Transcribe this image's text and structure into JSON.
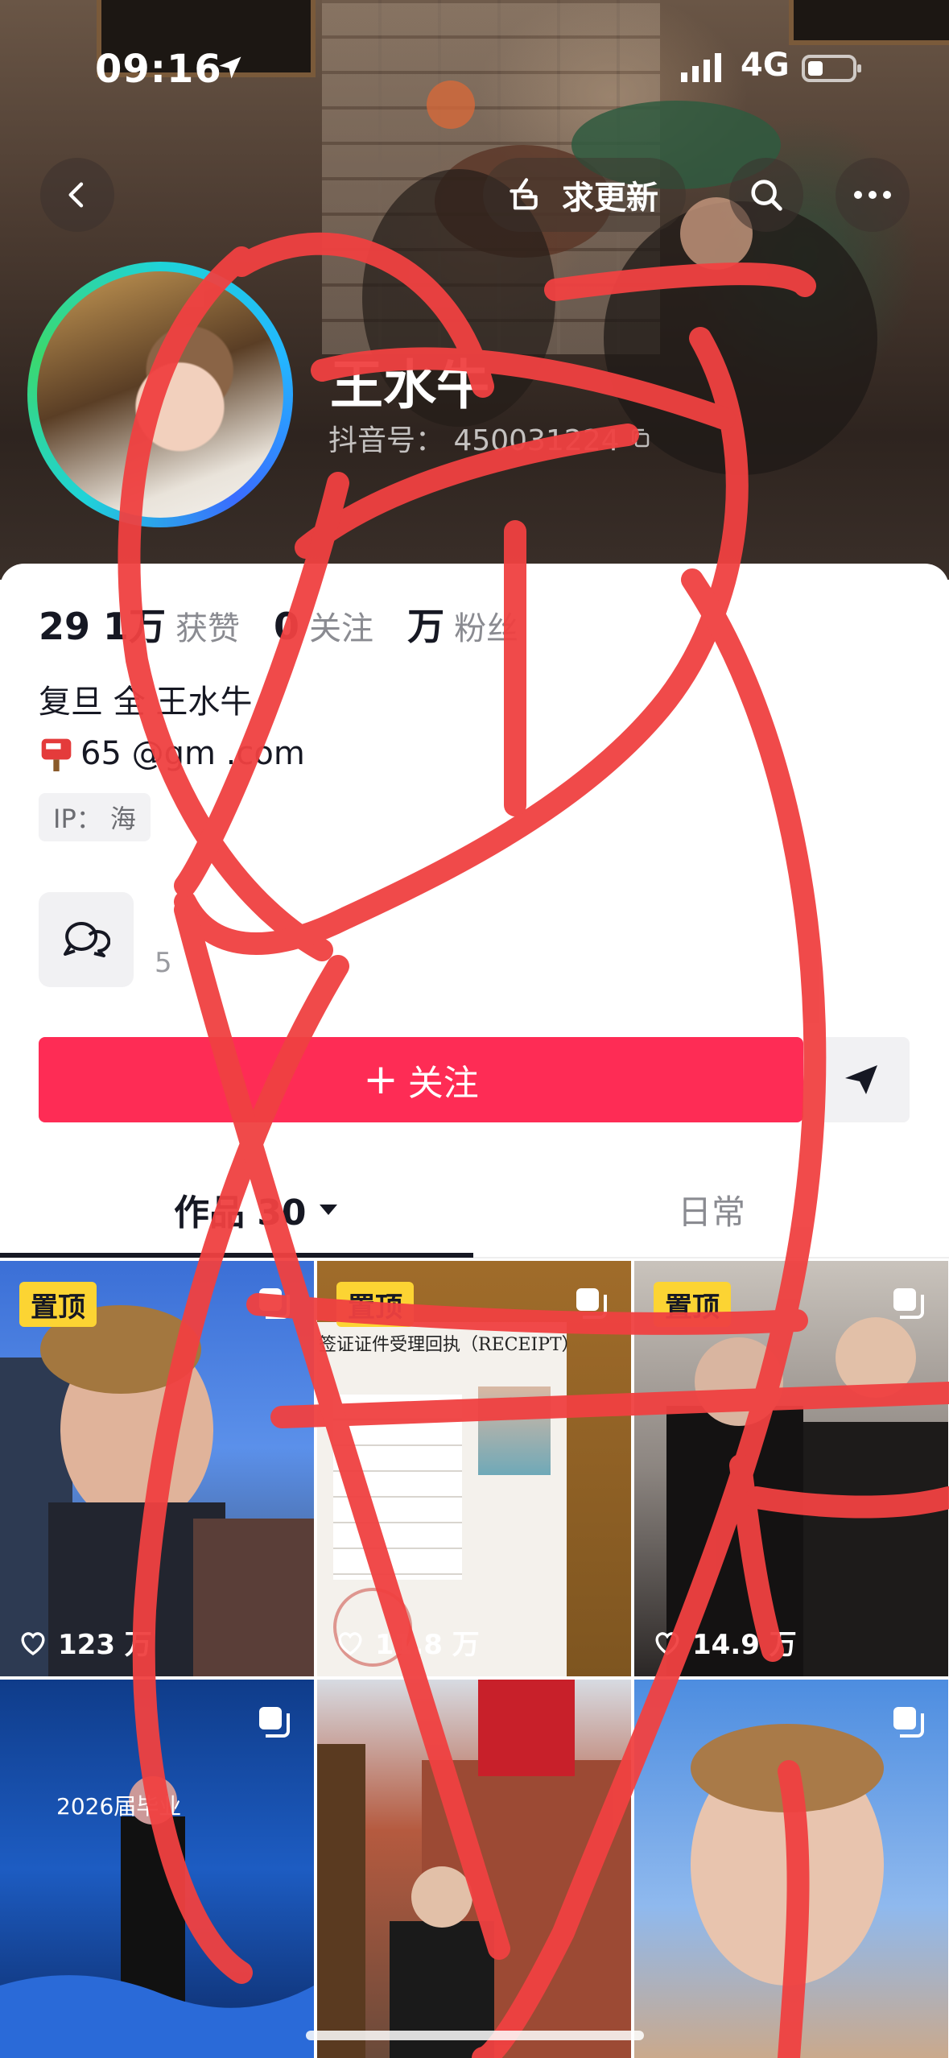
{
  "status_bar": {
    "time": "09:16",
    "network": "4G"
  },
  "nav": {
    "request_update_label": "求更新"
  },
  "profile": {
    "name": "王水牛",
    "douyin_id": "抖音号：    450031224",
    "stats": [
      {
        "num": "29  1万",
        "label": "获赞"
      },
      {
        "num": "0",
        "label": "关注"
      },
      {
        "num": "   万",
        "label": "粉丝"
      }
    ],
    "bio_line1": "复旦    全       王水牛",
    "bio_line2": "    65    @gm    .com",
    "ip_label": "IP：   海",
    "group_sub": "5"
  },
  "actions": {
    "follow_label": "关注"
  },
  "tabs": {
    "works_label": "作品 30",
    "daily_label": "日常"
  },
  "grid": {
    "pinned_label": "置顶",
    "tiles": [
      {
        "pinned": true,
        "likes": "123    万"
      },
      {
        "pinned": true,
        "likes": "11.8 万",
        "doc_title": "签证证件受理回执（RECEIPT）"
      },
      {
        "pinned": true,
        "likes": "14.9 万"
      },
      {
        "pinned": false,
        "likes": "",
        "banner_text": "2026届毕业"
      },
      {
        "pinned": false,
        "likes": ""
      },
      {
        "pinned": false,
        "likes": ""
      }
    ]
  },
  "colors": {
    "accent": "#fe2c55",
    "pinned_badge": "#fcd433",
    "scribble": "#f04141"
  }
}
